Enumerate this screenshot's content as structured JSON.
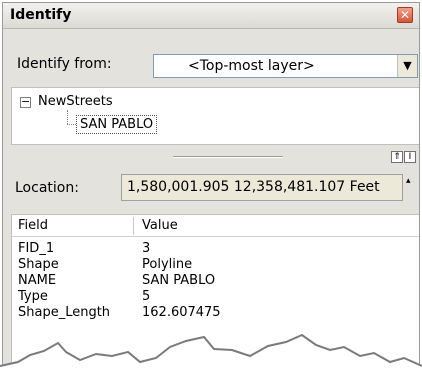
{
  "window": {
    "title": "Identify",
    "close_glyph": "✕"
  },
  "identify_from": {
    "label": "Identify from:",
    "selected": "<Top-most layer>",
    "dropdown_glyph": "▼"
  },
  "tree": {
    "toggle_glyph": "−",
    "root_label": "NewStreets",
    "child_label": "SAN PABLO"
  },
  "splitter": {
    "collapse_glyph": "⇑",
    "pin_glyph": "I"
  },
  "location": {
    "label": "Location:",
    "value": "1,580,001.905  12,358,481.107 Feet",
    "scroll_glyph": "▴"
  },
  "attributes": {
    "columns": [
      "Field",
      "Value"
    ],
    "rows": [
      {
        "field": "FID_1",
        "value": "3"
      },
      {
        "field": "Shape",
        "value": "Polyline"
      },
      {
        "field": "NAME",
        "value": "SAN PABLO"
      },
      {
        "field": "Type",
        "value": "5"
      },
      {
        "field": "Shape_Length",
        "value": "162.607475"
      }
    ]
  },
  "colors": {
    "window_bg": "#e4e2dd",
    "close_button": "#d4553a",
    "panel_bg": "#ffffff"
  }
}
